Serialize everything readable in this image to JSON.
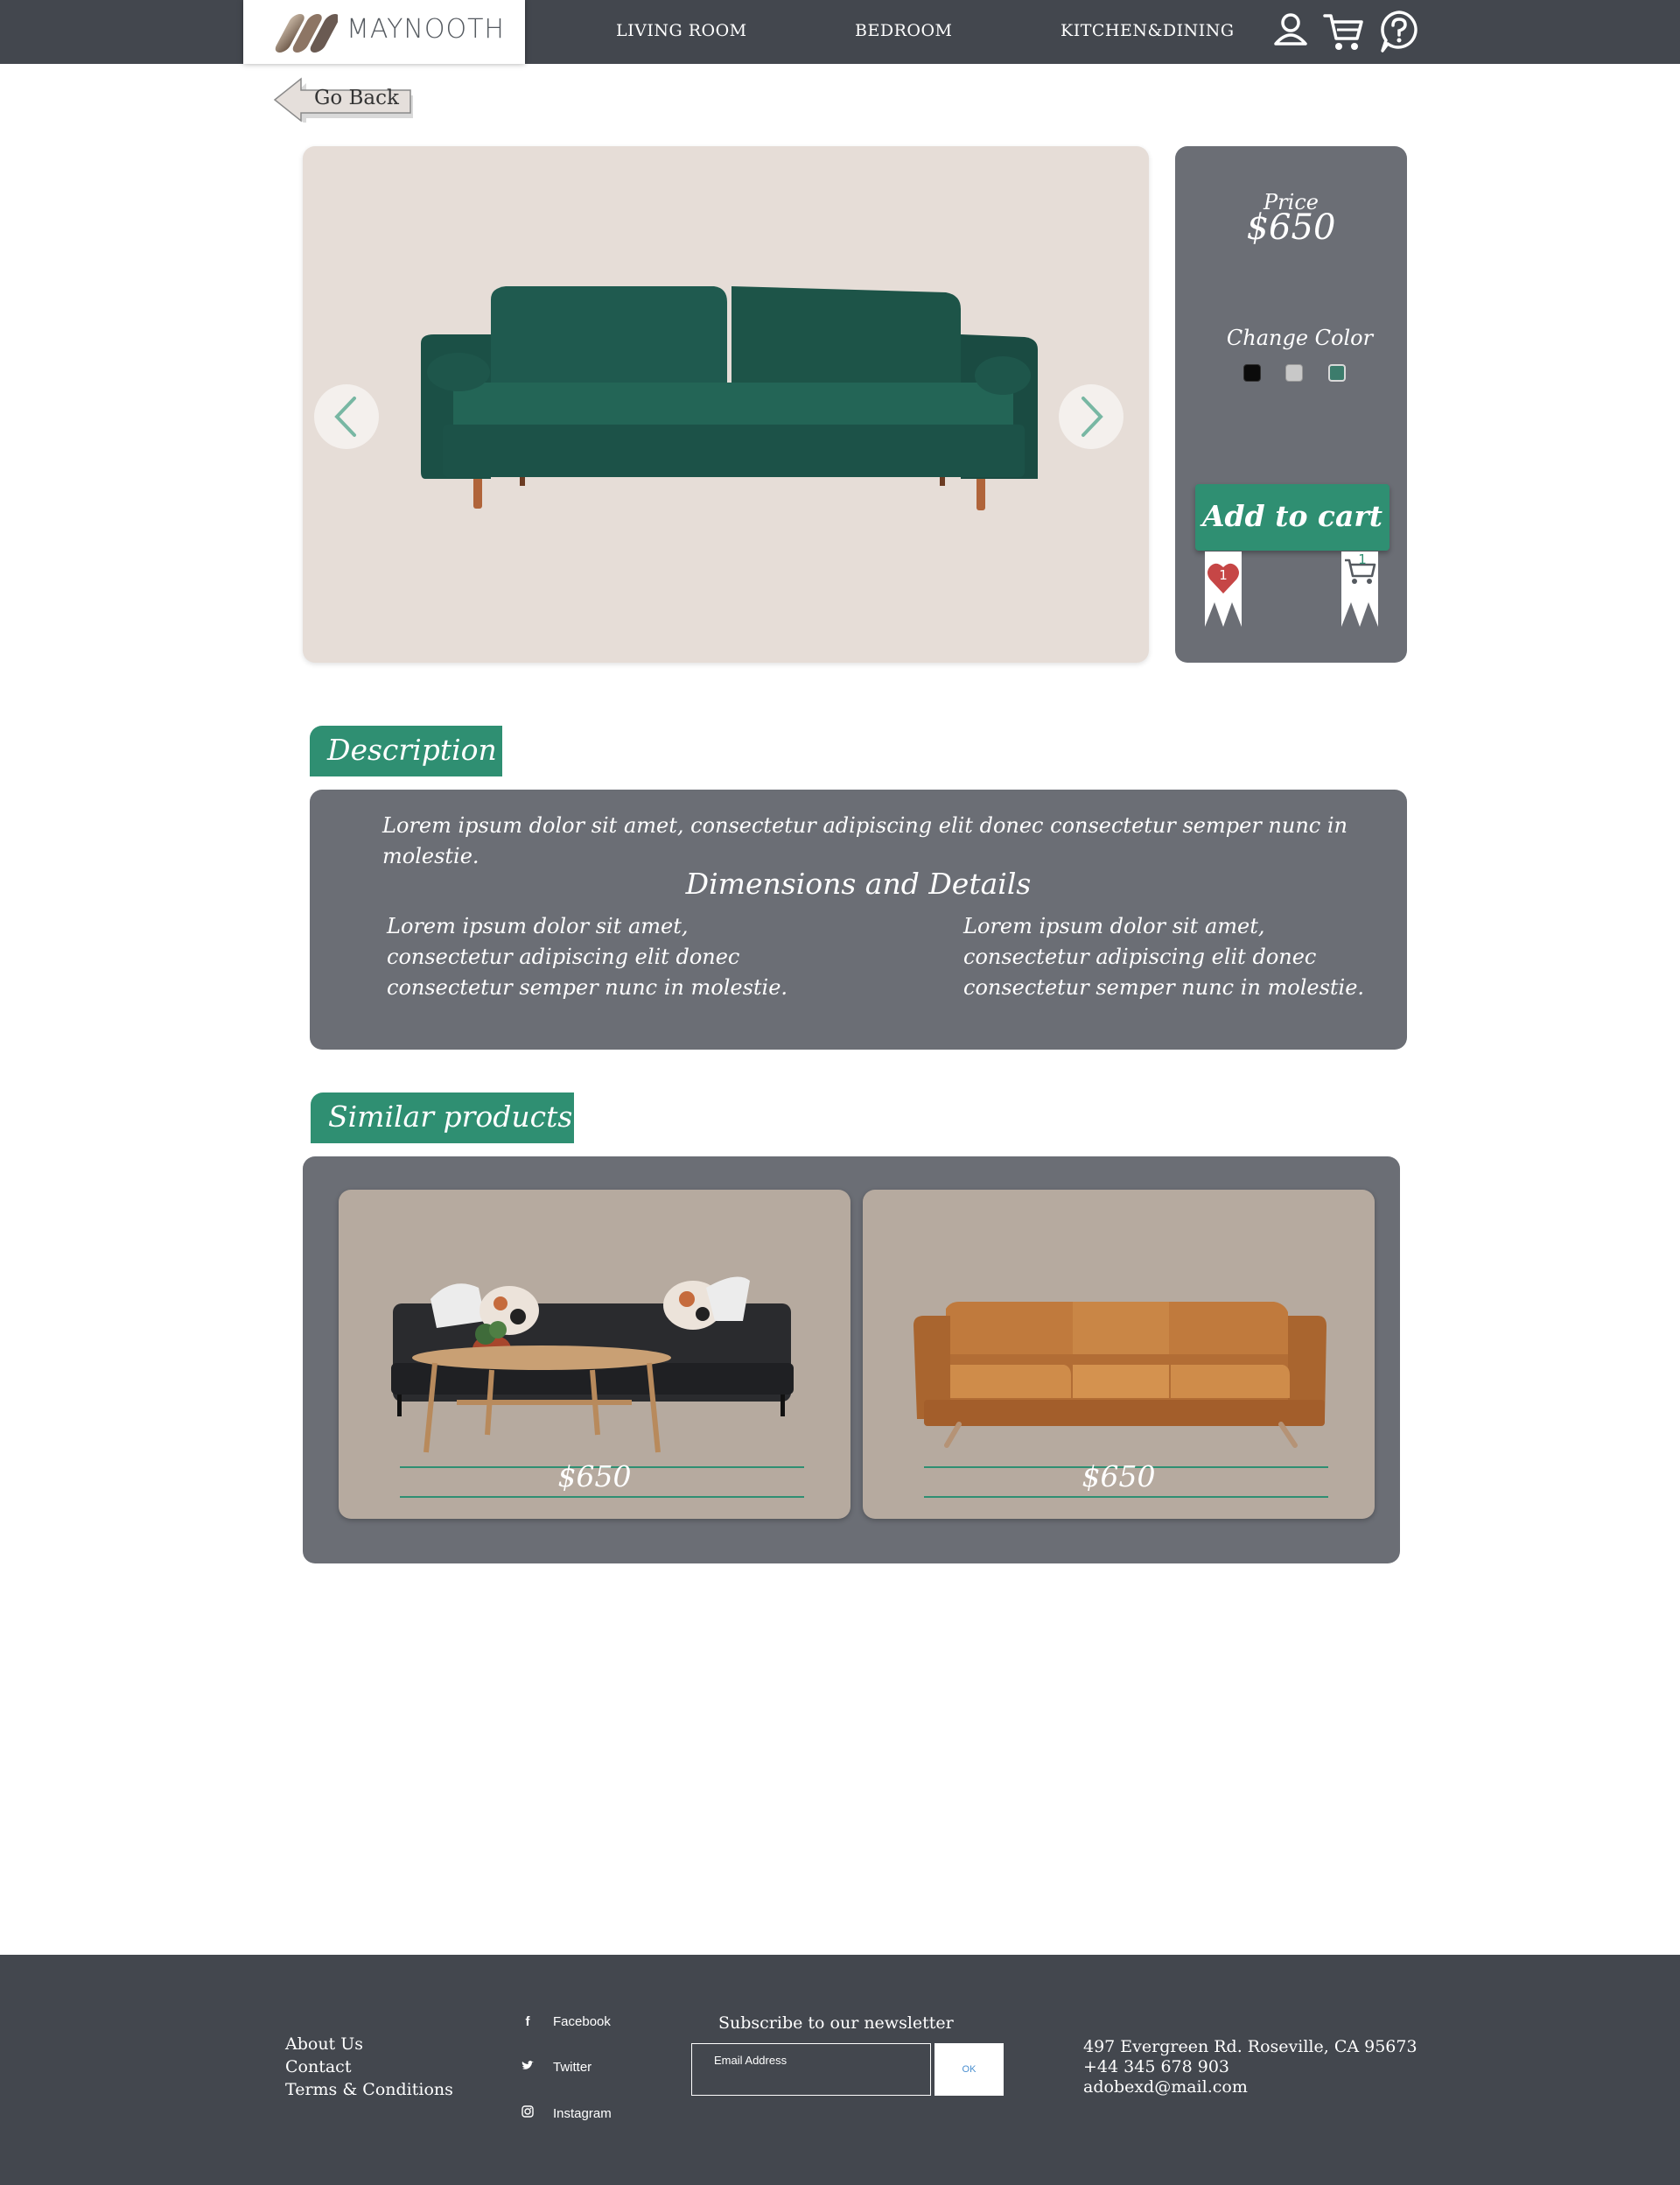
{
  "header": {
    "logo_text": "MAYNOOTH",
    "nav": [
      "LIVING ROOM",
      "BEDROOM",
      "KITCHEN&DINING"
    ]
  },
  "go_back_label": "Go Back",
  "product": {
    "price_label": "Price",
    "price": "$650",
    "change_color_label": "Change Color",
    "colors": [
      "#0b0b0b",
      "#c8c8c8",
      "#3c7c6c"
    ],
    "add_to_cart_label": "Add to cart",
    "wishlist_count": "1",
    "cart_count": "1"
  },
  "description": {
    "tab_label": "Description",
    "lead": "Lorem ipsum dolor sit amet, consectetur adipiscing elit   donec consectetur semper nunc in molestie.",
    "dimensions_title": "Dimensions and Details",
    "col_left": "Lorem ipsum dolor sit amet, consectetur adipiscing elit   donec consectetur semper nunc in molestie.",
    "col_right": "Lorem ipsum dolor sit amet, consectetur adipiscing elit   donec consectetur semper nunc in molestie."
  },
  "similar": {
    "tab_label": "Similar products",
    "items": [
      {
        "price": "$650"
      },
      {
        "price": "$650"
      }
    ]
  },
  "footer": {
    "links": [
      "About Us",
      "Contact",
      "Terms & Conditions"
    ],
    "social": [
      "Facebook",
      "Twitter",
      "Instagram"
    ],
    "newsletter_title": "Subscribe to our newsletter",
    "email_placeholder": "Email Address",
    "ok_label": "OK",
    "address": "497 Evergreen Rd. Roseville, CA 95673",
    "phone": "+44 345 678 903",
    "email": "adobexd@mail.com"
  }
}
